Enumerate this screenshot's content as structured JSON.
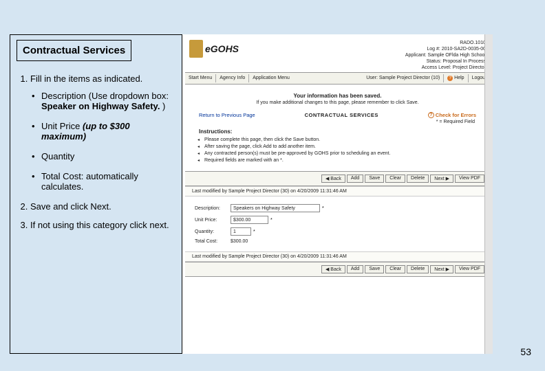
{
  "left": {
    "title": "Contractual Services",
    "step1_text": "Fill in the items as indicated.",
    "sub": {
      "desc_pre": "Description (Use dropdown box: ",
      "desc_bold": "Speaker on Highway Safety.",
      "desc_post": " )",
      "unitprice_pre": "Unit Price ",
      "unitprice_bi": "(up to $300 maximum)",
      "quantity": "Quantity",
      "total": "Total Cost: automatically calculates."
    },
    "step2": "Save and click Next.",
    "step3": "If not using this category click next."
  },
  "app": {
    "logo": "eGOHS",
    "meta": {
      "line1": "RADO.1010",
      "line2": "Log #: 2010-SA2D-0035-00",
      "line3": "Applicant: Sample OFlda High School",
      "line4": "Status: Proposal In Process",
      "line5": "Access Level: Project Director"
    },
    "nav": {
      "start": "Start Menu",
      "agency": "Agency Info",
      "appmenu": "Application Menu",
      "user": "User: Sample Project Director (10)",
      "help": "Help",
      "logout": "Logout"
    },
    "saved_title": "Your information has been saved.",
    "saved_sub": "If you make additional changes to this page, please remember to click Save.",
    "return_link": "Return to Previous Page",
    "svc_title": "CONTRACTUAL SERVICES",
    "check_errors": "Check for Errors",
    "req_field": "* = Required Field",
    "instr_head": "Instructions:",
    "instr": [
      "Please complete this page, then click the Save button.",
      "After saving the page, click Add to add another item.",
      "Any contracted person(s) must be pre-approved by GOHS prior to scheduling an event.",
      "Required fields are marked with an *."
    ],
    "buttons": {
      "back": "◀ Back",
      "add": "Add",
      "save": "Save",
      "clear": "Clear",
      "delete": "Delete",
      "next": "Next ▶",
      "viewpdf": "View PDF"
    },
    "lastmod": "Last modified by Sample Project Director (30) on 4/20/2009 11:31:46 AM",
    "form": {
      "desc_label": "Description:",
      "desc_value": "Speakers on Highway Safety",
      "unit_label": "Unit Price:",
      "unit_value": "$300.00",
      "qty_label": "Quantity:",
      "qty_value": "1",
      "total_label": "Total Cost:",
      "total_value": "$300.00"
    }
  },
  "page_number": "53"
}
